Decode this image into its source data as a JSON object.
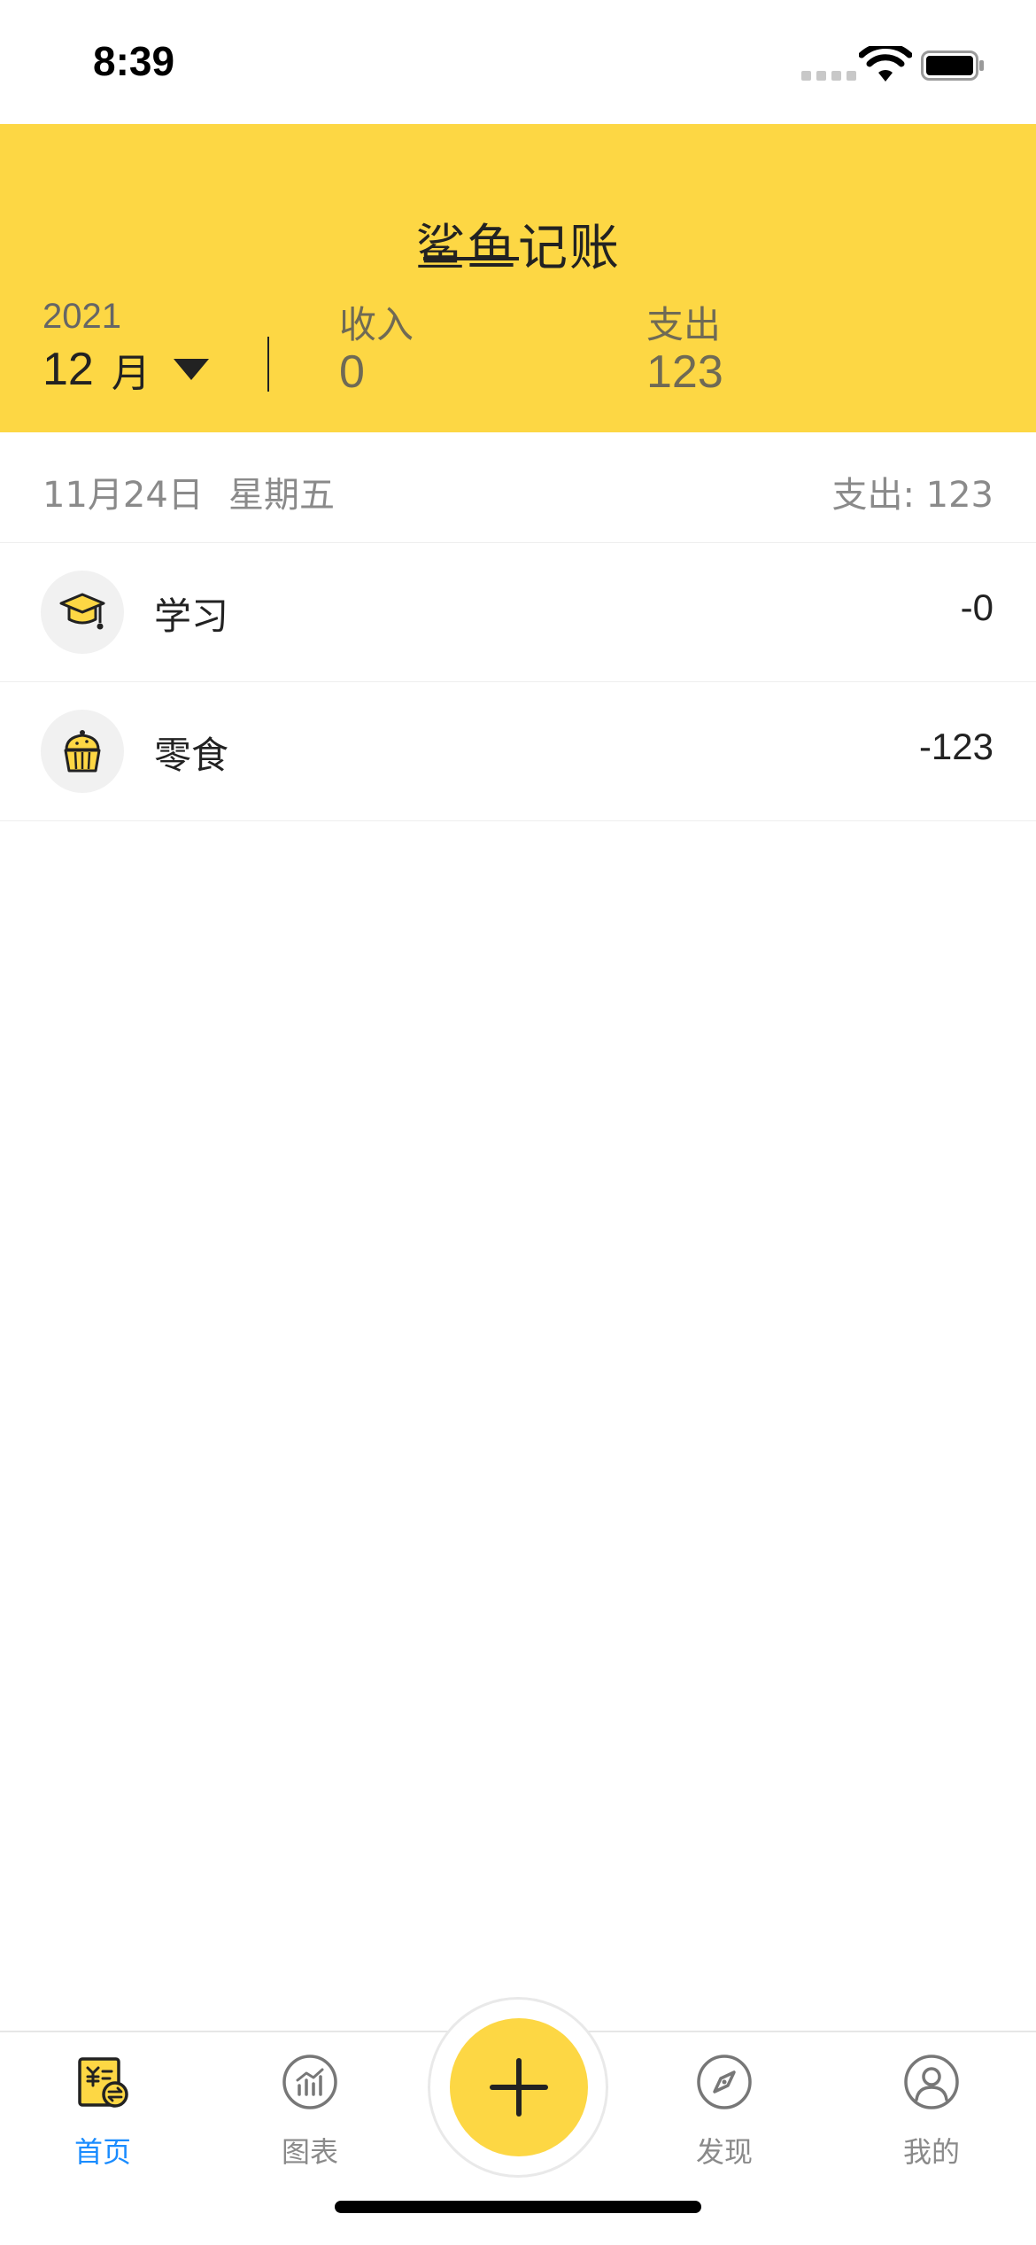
{
  "status_bar": {
    "time": "8:39"
  },
  "header": {
    "app_title": "鲨鱼记账",
    "year": "2021",
    "month": "12",
    "month_unit": "月",
    "income_label": "收入",
    "income_value": "0",
    "expense_label": "支出",
    "expense_value": "123",
    "background_color": "#FDD744"
  },
  "day_group": {
    "date": "11月24日",
    "weekday": "星期五",
    "total": "支出: 123"
  },
  "records": [
    {
      "icon": "graduation-cap-icon",
      "label": "学习",
      "amount": "-0"
    },
    {
      "icon": "cupcake-icon",
      "label": "零食",
      "amount": "-123"
    }
  ],
  "tabbar": {
    "tabs": [
      {
        "label": "首页",
        "icon": "ledger-icon",
        "active": true
      },
      {
        "label": "图表",
        "icon": "chart-icon",
        "active": false
      },
      {
        "label": "发现",
        "icon": "compass-icon",
        "active": false
      },
      {
        "label": "我的",
        "icon": "user-icon",
        "active": false
      }
    ],
    "add_icon": "plus-icon",
    "active_color": "#1a8cff",
    "accent_color": "#FDD744"
  }
}
